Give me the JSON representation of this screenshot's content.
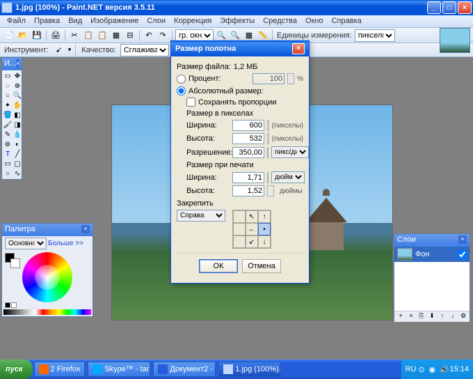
{
  "titlebar": {
    "text": "1.jpg (100%) - Paint.NET версия 3.5.11"
  },
  "menu": {
    "file": "Файл",
    "edit": "Правка",
    "view": "Вид",
    "image": "Изображение",
    "layers": "Слои",
    "correct": "Коррекция",
    "effects": "Эффекты",
    "tools_m": "Средства",
    "window": "Окно",
    "help": "Справка"
  },
  "toolbar": {
    "units_label": "Единицы измерения:",
    "units_value": "пикселы",
    "fit_label": "гр. окна"
  },
  "toolbar2": {
    "tool_label": "Инструмент:",
    "quality_label": "Качество:",
    "quality_value": "Сглажива..."
  },
  "tools_panel": {
    "title": "И..."
  },
  "dialog": {
    "title": "Размер полотна",
    "filesize_label": "Размер файла:",
    "filesize": "1,2 МБ",
    "percent_label": "Процент:",
    "percent_val": "100",
    "percent_unit": "%",
    "abs_label": "Абсолютный размер:",
    "keep_ratio": "Сохранять пропорции",
    "px_section": "Размер в пикселах",
    "width_label": "Ширина:",
    "width_val": "600",
    "width_unit": "(пикселы)",
    "height_label": "Высота:",
    "height_val": "532",
    "height_unit": "(пикселы)",
    "res_label": "Разрешение:",
    "res_val": "350,00",
    "res_unit": "пикс/дюйм",
    "print_section": "Размер при печати",
    "pwidth_label": "Ширина:",
    "pwidth_val": "1,71",
    "pwidth_unit": "дюймы",
    "pheight_label": "Высота:",
    "pheight_val": "1,52",
    "pheight_unit": "дюймы",
    "anchor_label": "Закрепить",
    "anchor_value": "Справа",
    "ok": "ОК",
    "cancel": "Отмена"
  },
  "palette": {
    "title": "Палитра",
    "primary": "Основной",
    "more": "Больше >>"
  },
  "layers": {
    "title": "Слои",
    "bg_name": "Фон"
  },
  "taskbar": {
    "start": "пуск",
    "items": [
      "2 Firefox",
      "Skype™ - tarr...",
      "Документ2 - ...",
      "1.jpg (100%)..."
    ],
    "lang": "RU",
    "time": "15:14"
  }
}
